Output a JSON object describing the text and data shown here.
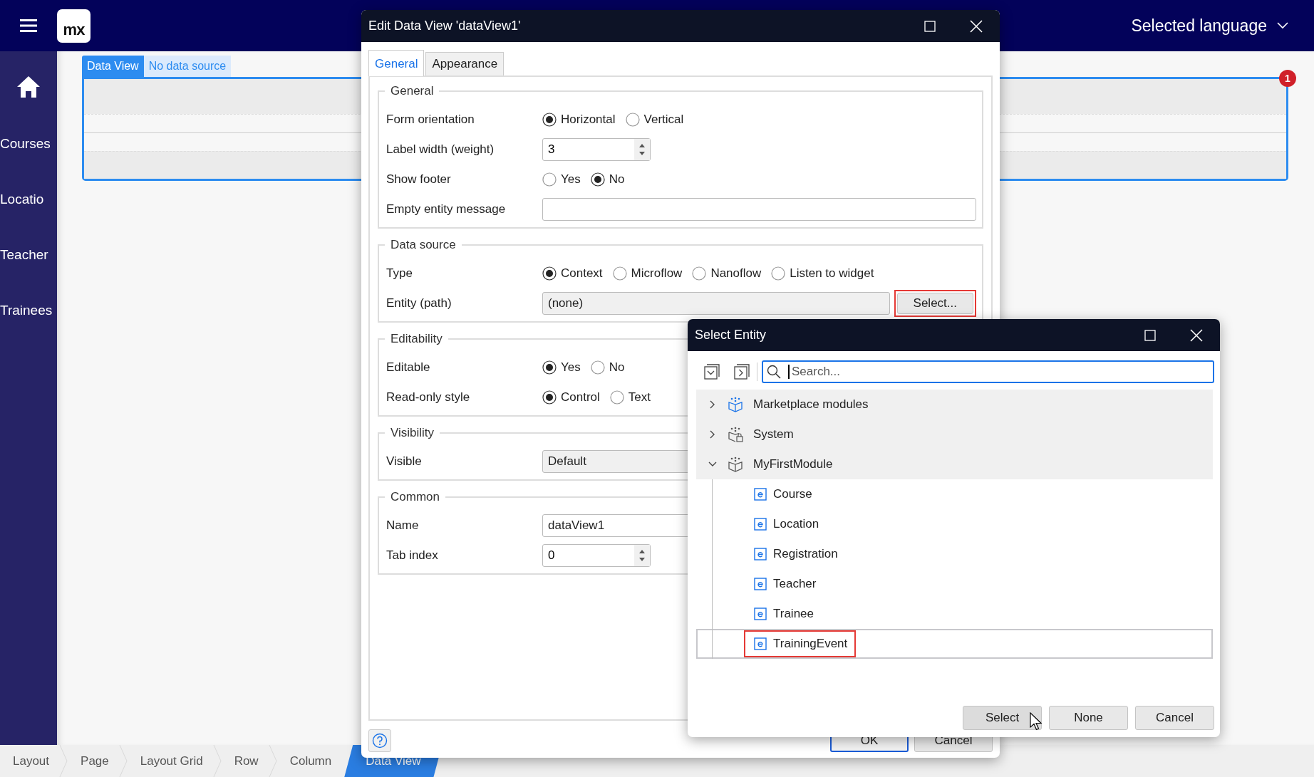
{
  "top_bar": {
    "logo": "mx",
    "language_menu": "Selected language"
  },
  "sidebar": {
    "items": [
      {
        "label": "Courses"
      },
      {
        "label": "Locatio"
      },
      {
        "label": "Teacher"
      },
      {
        "label": "Trainees"
      }
    ]
  },
  "widget": {
    "tab": "Data View",
    "caption": "No data source",
    "error_count": "1"
  },
  "breadcrumb": [
    {
      "label": "Layout",
      "selected": false
    },
    {
      "label": "Page",
      "selected": false
    },
    {
      "label": "Layout Grid",
      "selected": false
    },
    {
      "label": "Row",
      "selected": false
    },
    {
      "label": "Column",
      "selected": false
    },
    {
      "label": "Data View",
      "selected": true
    }
  ],
  "edit_dialog": {
    "title": "Edit Data View 'dataView1'",
    "tabs": [
      {
        "label": "General",
        "selected": true
      },
      {
        "label": "Appearance",
        "selected": false
      }
    ],
    "groups": [
      {
        "title": "General",
        "fields": [
          {
            "label": "Form orientation",
            "kind": "radio",
            "options": [
              {
                "label": "Horizontal",
                "selected": true
              },
              {
                "label": "Vertical",
                "selected": false
              }
            ]
          },
          {
            "label": "Label width (weight)",
            "kind": "spin",
            "value": "3"
          },
          {
            "label": "Show footer",
            "kind": "radio",
            "options": [
              {
                "label": "Yes",
                "selected": false
              },
              {
                "label": "No",
                "selected": true
              }
            ]
          },
          {
            "label": "Empty entity message",
            "kind": "text"
          }
        ]
      },
      {
        "title": "Data source",
        "fields": [
          {
            "label": "Type",
            "kind": "radio",
            "options": [
              {
                "label": "Context",
                "selected": true
              },
              {
                "label": "Microflow",
                "selected": false
              },
              {
                "label": "Nanoflow",
                "selected": false
              },
              {
                "label": "Listen to widget",
                "selected": false
              }
            ]
          },
          {
            "label": "Entity (path)",
            "kind": "picker",
            "value": "(none)",
            "button": {
              "label": "Select...",
              "highlighted": true
            }
          }
        ]
      },
      {
        "title": "Editability",
        "fields": [
          {
            "label": "Editable",
            "kind": "radio",
            "options": [
              {
                "label": "Yes",
                "selected": true
              },
              {
                "label": "No",
                "selected": false
              }
            ]
          },
          {
            "label": "Read-only style",
            "kind": "radio",
            "options": [
              {
                "label": "Control",
                "selected": true
              },
              {
                "label": "Text",
                "selected": false
              }
            ]
          }
        ]
      },
      {
        "title": "Visibility",
        "fields": [
          {
            "label": "Visible",
            "kind": "dropdown",
            "value": "Default"
          }
        ]
      },
      {
        "title": "Common",
        "fields": [
          {
            "label": "Name",
            "kind": "text",
            "value": "dataView1"
          },
          {
            "label": "Tab index",
            "kind": "spin",
            "value": "0"
          }
        ]
      }
    ],
    "buttons": [
      {
        "label": "OK",
        "primary": true
      },
      {
        "label": "Cancel",
        "primary": false
      }
    ]
  },
  "select_dialog": {
    "title": "Select Entity",
    "search": {
      "placeholder": "Search..."
    },
    "tree": [
      {
        "label": "Marketplace modules",
        "kind": "module",
        "expanded": false
      },
      {
        "label": "System",
        "kind": "system",
        "expanded": false
      },
      {
        "label": "MyFirstModule",
        "kind": "module",
        "expanded": true,
        "children": [
          {
            "label": "Course",
            "selected": false,
            "highlighted": false
          },
          {
            "label": "Location",
            "selected": false,
            "highlighted": false
          },
          {
            "label": "Registration",
            "selected": false,
            "highlighted": false
          },
          {
            "label": "Teacher",
            "selected": false,
            "highlighted": false
          },
          {
            "label": "Trainee",
            "selected": false,
            "highlighted": false
          },
          {
            "label": "TrainingEvent",
            "selected": true,
            "highlighted": true
          }
        ]
      }
    ],
    "buttons": [
      {
        "label": "Select",
        "primary": true
      },
      {
        "label": "None",
        "primary": false
      },
      {
        "label": "Cancel",
        "primary": false
      }
    ]
  }
}
